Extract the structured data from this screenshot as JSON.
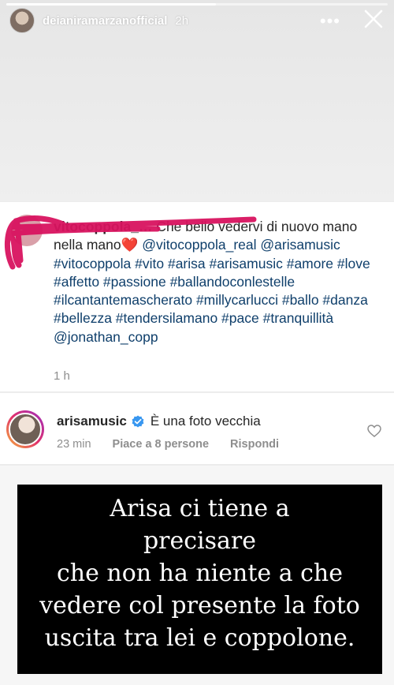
{
  "story": {
    "username": "deianiramarzanofficial",
    "time": "2h",
    "more_label": "•••",
    "progress": 0.55
  },
  "comment": {
    "user": "vitocoppola_…",
    "text_lead": "Che bello vedervi di nuovo mano nella mano",
    "emoji": "❤️",
    "tags": "@vitocoppola_real @arisamusic #vitocoppola #vito #arisa #arisamusic #amore #love #affetto #passione #ballandoconlestelle #ilcantantemascherato #millycarlucci #ballo #danza #bellezza #tendersilamano #pace #tranquillità @jonathan_copp",
    "time": "1 h"
  },
  "reply": {
    "user": "arisamusic",
    "text": "È una foto vecchia",
    "time": "23 min",
    "likes": "Piace a 8 persone",
    "reply_label": "Rispondi"
  },
  "caption": {
    "lines": [
      "Arisa ci tiene a",
      "precisare",
      "che non ha niente a che",
      "vedere col presente la foto",
      "uscita tra lei e coppolone."
    ]
  },
  "colors": {
    "hashtag": "#0f3f6b",
    "scribble": "#d8135f",
    "verified": "#3897f0"
  }
}
